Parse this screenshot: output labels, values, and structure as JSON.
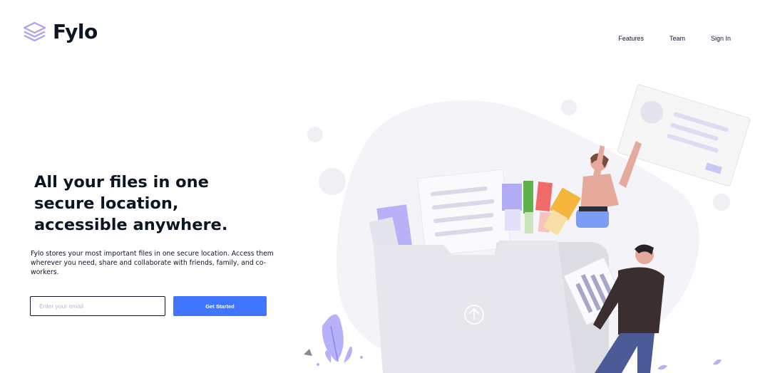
{
  "header": {
    "logo_text": "Fylo",
    "logo_icon": "stacked-layers-icon",
    "nav": [
      {
        "label": "Features"
      },
      {
        "label": "Team"
      },
      {
        "label": "Sign In"
      }
    ]
  },
  "hero": {
    "title": "All your files in one secure location, accessible anywhere.",
    "description": "Fylo stores your most important files in one secure location. Access them wherever you need, share and collaborate with friends, family, and co-workers.",
    "email_placeholder": "Enter your email",
    "cta_label": "Get Started"
  },
  "colors": {
    "text": "#0c1524",
    "accent": "#3f75ff",
    "logo": "#a9a1f2",
    "placeholder": "#b9bcc4"
  }
}
